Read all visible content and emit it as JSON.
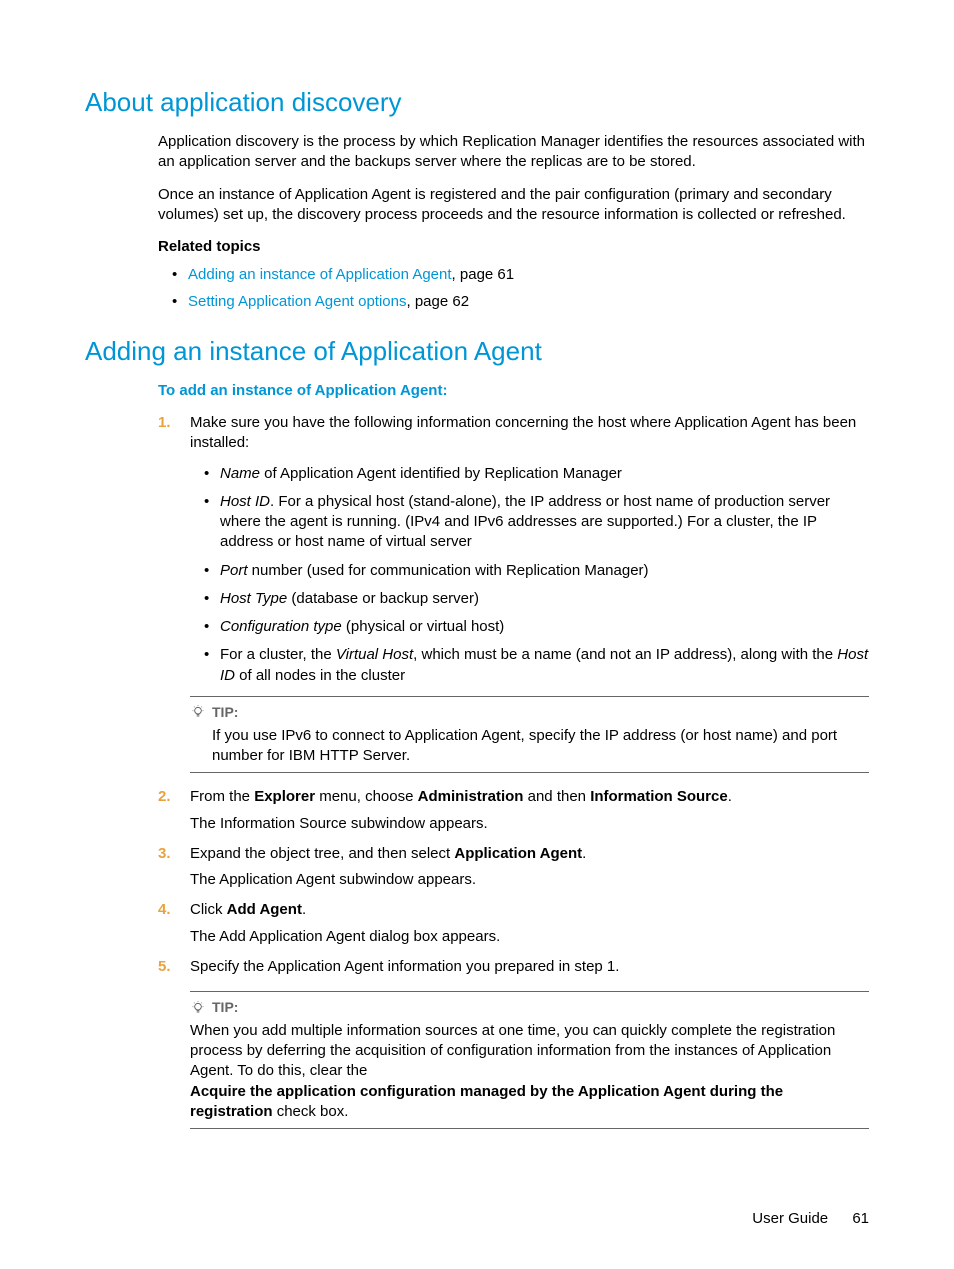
{
  "section1": {
    "title": "About application discovery",
    "para1": "Application discovery is the process by which Replication Manager identifies the resources associated with an application server and the backups server where the replicas are to be stored.",
    "para2": "Once an instance of Application Agent is registered and the pair configuration (primary and secondary volumes) set up, the discovery process proceeds and the resource information is collected or refreshed.",
    "relatedTopicsHeading": "Related topics",
    "related": [
      {
        "link": "Adding an instance of Application Agent",
        "suffix": ", page 61"
      },
      {
        "link": "Setting Application Agent options",
        "suffix": ", page 62"
      }
    ]
  },
  "section2": {
    "title": "Adding an instance of Application Agent",
    "subheading": "To add an instance of Application Agent:",
    "step1": {
      "text": "Make sure you have the following information concerning the host where Application Agent has been installed:",
      "items": {
        "a_pre": "Name",
        "a_post": " of Application Agent identified by Replication Manager",
        "b_pre": "Host ID",
        "b_post": ". For a physical host (stand-alone), the IP address or host name of production server where the agent is running. (IPv4 and IPv6 addresses are supported.) For a cluster, the IP address or host name of virtual server",
        "c_pre": "Port",
        "c_post": " number (used for communication with Replication Manager)",
        "d_pre": "Host Type",
        "d_post": " (database or backup server)",
        "e_pre": "Configuration type",
        "e_post": " (physical or virtual host)",
        "f_t1": "For a cluster, the ",
        "f_em1": "Virtual Host",
        "f_t2": ", which must be a name (and not an IP address), along with the ",
        "f_em2": "Host ID",
        "f_t3": " of all nodes in the cluster"
      }
    },
    "tip1": {
      "label": "TIP:",
      "body": "If you use IPv6 to connect to Application Agent, specify the IP address (or host name) and port number for IBM HTTP Server."
    },
    "step2": {
      "t1": "From the ",
      "b1": "Explorer",
      "t2": " menu, choose ",
      "b2": "Administration",
      "t3": " and then ",
      "b3": "Information Source",
      "t4": ".",
      "sub": "The Information Source subwindow appears."
    },
    "step3": {
      "t1": "Expand the object tree, and then select ",
      "b1": "Application Agent",
      "t2": ".",
      "sub": "The Application Agent subwindow appears."
    },
    "step4": {
      "t1": "Click ",
      "b1": "Add Agent",
      "t2": ".",
      "sub": "The Add Application Agent dialog box appears."
    },
    "step5": {
      "text": "Specify the Application Agent information you prepared in step 1."
    },
    "tip2": {
      "label": "TIP:",
      "body1": "When you add multiple information sources at one time, you can quickly complete the registration process by deferring the acquisition of configuration information from the instances of Application Agent. To do this, clear the",
      "bold": "Acquire the application configuration managed by the Application Agent during the registration",
      "body2": "check box."
    }
  },
  "footer": {
    "label": "User Guide",
    "page": "61"
  }
}
